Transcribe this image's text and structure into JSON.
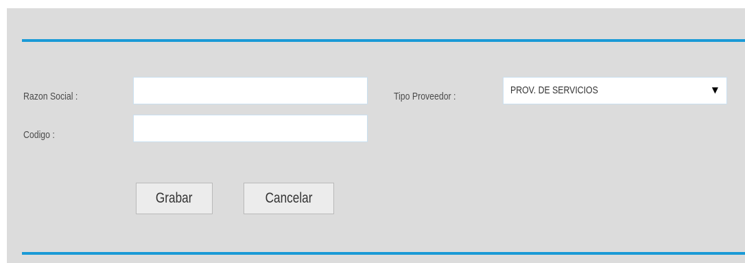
{
  "form": {
    "razon_social": {
      "label": "Razon Social :",
      "value": ""
    },
    "codigo": {
      "label": "Codigo :",
      "value": ""
    },
    "tipo_proveedor": {
      "label": "Tipo Proveedor :",
      "selected": "PROV. DE SERVICIOS",
      "arrow": "▼"
    }
  },
  "buttons": {
    "save_label": "Grabar",
    "cancel_label": "Cancelar"
  },
  "colors": {
    "panel_background": "#dcdcdc",
    "rule_accent": "#1a9ad6",
    "input_border": "#c9dff0"
  }
}
